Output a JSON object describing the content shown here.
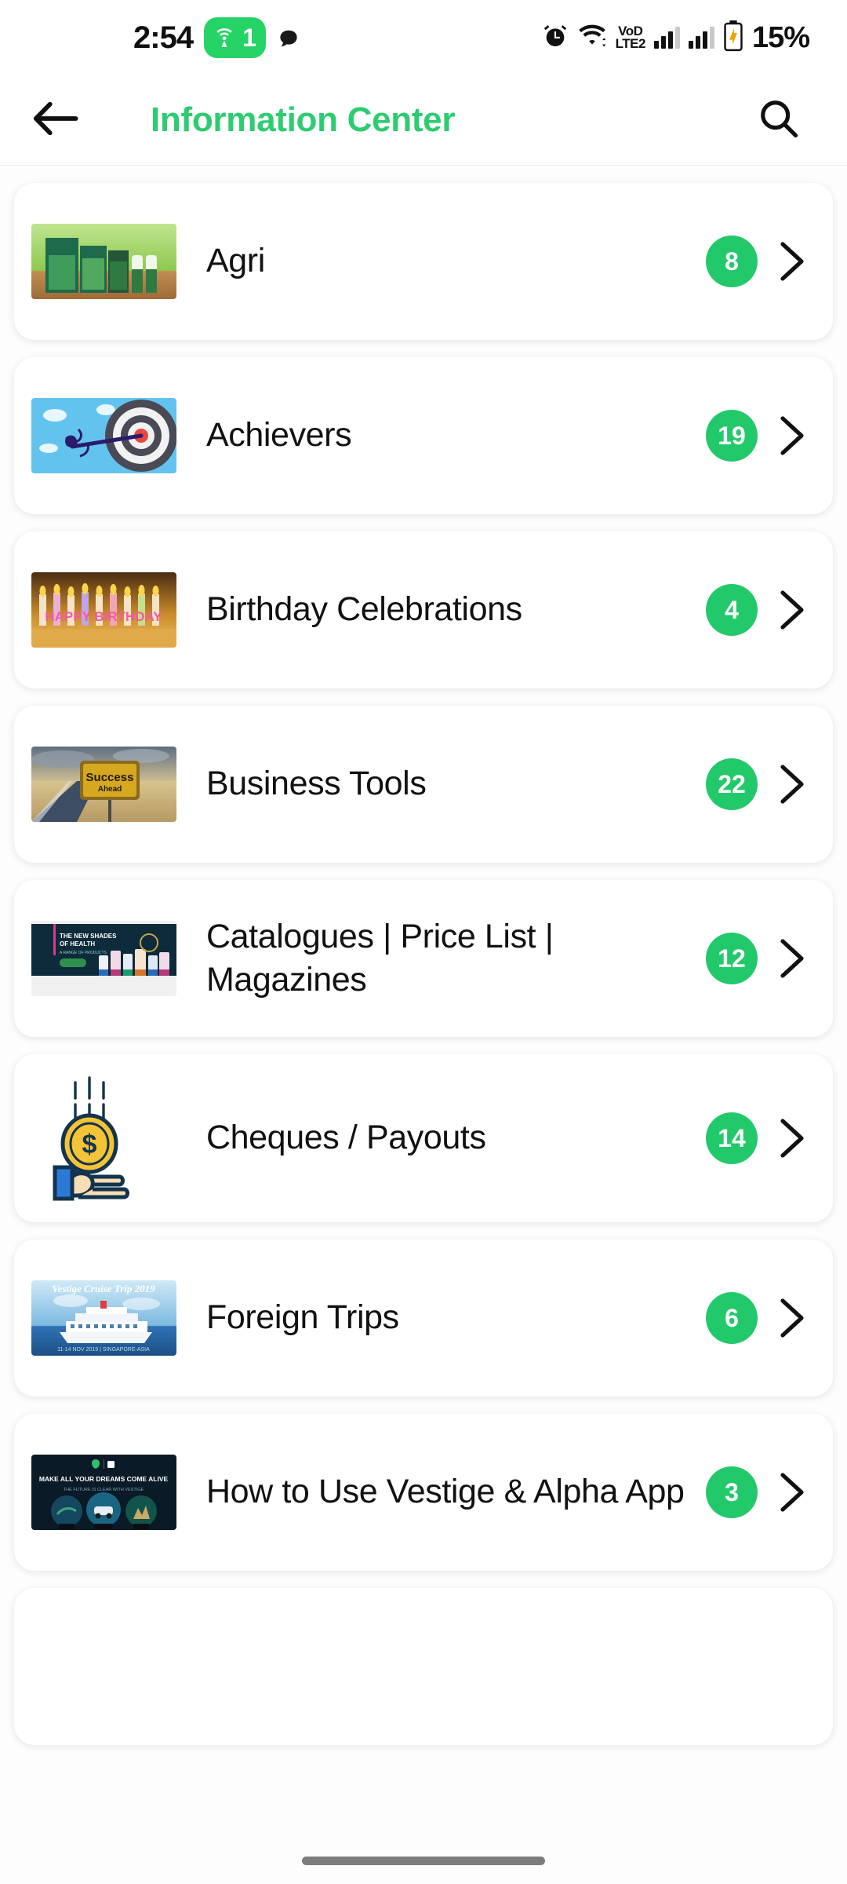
{
  "status_bar": {
    "time": "2:54",
    "hotspot_count": "1",
    "hotspot_icon": "hotspot-icon",
    "chat_icon": "chat-bubble-icon",
    "alarm_icon": "alarm-clock-icon",
    "wifi_icon": "wifi-icon",
    "network_type": {
      "line1": "VoD",
      "line2": "LTE2"
    },
    "signal_icon_1": "signal-bars-icon",
    "signal_icon_2": "signal-bars-icon",
    "battery_icon": "battery-charging-icon",
    "battery_percent": "15%"
  },
  "app_bar": {
    "back_icon": "back-arrow-icon",
    "title": "Information Center",
    "title_color": "#2ECC71",
    "search_icon": "search-icon"
  },
  "theme": {
    "badge_color": "#22C96A",
    "badge_text_color": "#FFFFFF",
    "card_background": "#FFFFFF",
    "page_background": "#FDFDFD"
  },
  "list": {
    "items": [
      {
        "label": "Agri",
        "count": "8",
        "thumbnail": "agri-products-thumbnail",
        "chevron_icon": "chevron-right-icon"
      },
      {
        "label": "Achievers",
        "count": "19",
        "thumbnail": "dartboard-target-thumbnail",
        "chevron_icon": "chevron-right-icon"
      },
      {
        "label": "Birthday Celebrations",
        "count": "4",
        "thumbnail": "birthday-candles-thumbnail",
        "chevron_icon": "chevron-right-icon"
      },
      {
        "label": "Business Tools",
        "count": "22",
        "thumbnail": "success-ahead-road-sign-thumbnail",
        "chevron_icon": "chevron-right-icon"
      },
      {
        "label": "Catalogues | Price List | Magazines",
        "count": "12",
        "thumbnail": "product-catalogue-banner-thumbnail",
        "chevron_icon": "chevron-right-icon"
      },
      {
        "label": "Cheques / Payouts",
        "count": "14",
        "thumbnail": "hand-catching-coin-thumbnail",
        "chevron_icon": "chevron-right-icon"
      },
      {
        "label": "Foreign Trips",
        "count": "6",
        "thumbnail": "cruise-ship-thumbnail",
        "chevron_icon": "chevron-right-icon"
      },
      {
        "label": "How to Use Vestige & Alpha App",
        "count": "3",
        "thumbnail": "dreams-come-alive-banner-thumbnail",
        "chevron_icon": "chevron-right-icon"
      }
    ]
  },
  "gesture_bar": {
    "handle": "home-gesture-handle"
  }
}
